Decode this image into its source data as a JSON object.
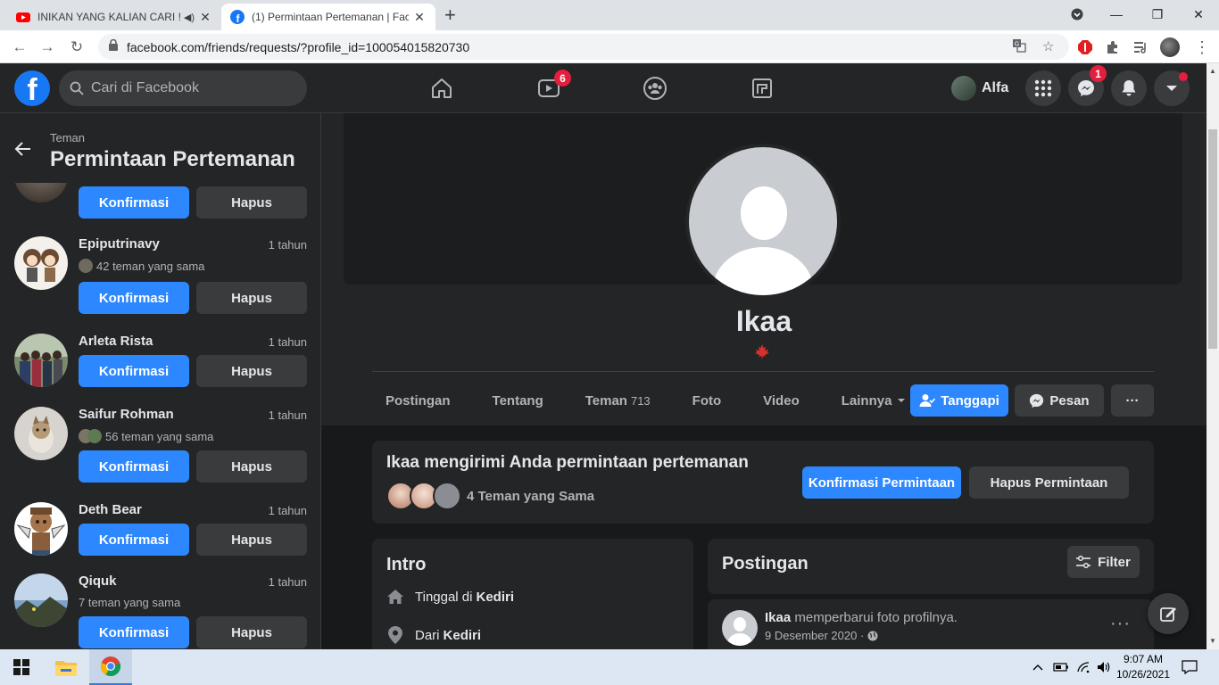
{
  "browser": {
    "tabs": [
      {
        "title": "INIKAN YANG KALIAN CARI !!",
        "icon": "youtube-icon"
      },
      {
        "title": "(1) Permintaan Pertemanan | Facebook",
        "icon": "facebook-icon"
      }
    ],
    "url": "facebook.com/friends/requests/?profile_id=100054015820730"
  },
  "fb_header": {
    "logo": "f",
    "search_placeholder": "Cari di Facebook",
    "watch_badge": "6",
    "profile_name": "Alfa",
    "messenger_badge": "1"
  },
  "sidebar": {
    "breadcrumb": "Teman",
    "title": "Permintaan Pertemanan",
    "confirm_label": "Konfirmasi",
    "delete_label": "Hapus",
    "requests": [
      {
        "name": "Epiputrinavy",
        "time": "1 tahun",
        "mutual": "42 teman yang sama"
      },
      {
        "name": "Arleta Rista",
        "time": "1 tahun",
        "mutual": ""
      },
      {
        "name": "Saifur Rohman",
        "time": "1 tahun",
        "mutual": "56 teman yang sama"
      },
      {
        "name": "Deth Bear",
        "time": "1 tahun",
        "mutual": ""
      },
      {
        "name": "Qiquk",
        "time": "1 tahun",
        "mutual": "7 teman yang sama"
      }
    ]
  },
  "profile": {
    "name": "Ikaa",
    "tabs": [
      {
        "label": "Postingan",
        "count": ""
      },
      {
        "label": "Tentang",
        "count": ""
      },
      {
        "label": "Teman",
        "count": "713"
      },
      {
        "label": "Foto",
        "count": ""
      },
      {
        "label": "Video",
        "count": ""
      },
      {
        "label": "Lainnya",
        "count": ""
      }
    ],
    "respond_label": "Tanggapi",
    "message_label": "Pesan",
    "more_label": "···"
  },
  "request_card": {
    "title": "Ikaa mengirimi Anda permintaan pertemanan",
    "mutual": "4 Teman yang Sama",
    "confirm_label": "Konfirmasi Permintaan",
    "delete_label": "Hapus Permintaan"
  },
  "intro": {
    "title": "Intro",
    "lives_prefix": "Tinggal di",
    "lives_city": "Kediri",
    "from_prefix": "Dari",
    "from_city": "Kediri"
  },
  "posts": {
    "title": "Postingan",
    "filter_label": "Filter",
    "post_author": "Ikaa",
    "post_action": "memperbarui foto profilnya.",
    "post_date": "9 Desember 2020 ·"
  },
  "taskbar": {
    "time": "9:07 AM",
    "date": "10/26/2021"
  },
  "colors": {
    "fb_blue": "#2d88ff",
    "fb_dark": "#18191a",
    "fb_card": "#242526",
    "badge_red": "#e41e3f"
  }
}
